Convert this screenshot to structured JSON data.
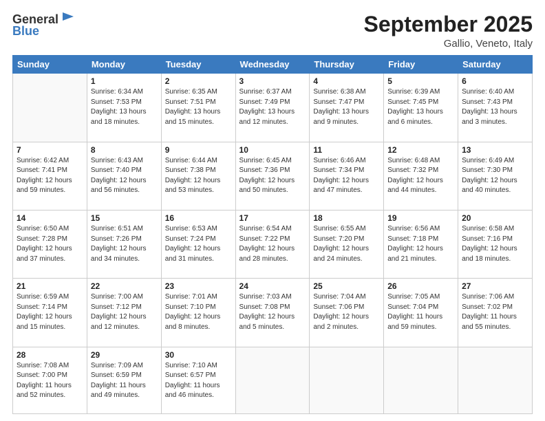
{
  "logo": {
    "line1": "General",
    "line2": "Blue"
  },
  "header": {
    "title": "September 2025",
    "subtitle": "Gallio, Veneto, Italy"
  },
  "days": [
    "Sunday",
    "Monday",
    "Tuesday",
    "Wednesday",
    "Thursday",
    "Friday",
    "Saturday"
  ],
  "weeks": [
    [
      {
        "num": "",
        "sunrise": "",
        "sunset": "",
        "daylight": "",
        "empty": true
      },
      {
        "num": "1",
        "sunrise": "Sunrise: 6:34 AM",
        "sunset": "Sunset: 7:53 PM",
        "daylight": "Daylight: 13 hours and 18 minutes."
      },
      {
        "num": "2",
        "sunrise": "Sunrise: 6:35 AM",
        "sunset": "Sunset: 7:51 PM",
        "daylight": "Daylight: 13 hours and 15 minutes."
      },
      {
        "num": "3",
        "sunrise": "Sunrise: 6:37 AM",
        "sunset": "Sunset: 7:49 PM",
        "daylight": "Daylight: 13 hours and 12 minutes."
      },
      {
        "num": "4",
        "sunrise": "Sunrise: 6:38 AM",
        "sunset": "Sunset: 7:47 PM",
        "daylight": "Daylight: 13 hours and 9 minutes."
      },
      {
        "num": "5",
        "sunrise": "Sunrise: 6:39 AM",
        "sunset": "Sunset: 7:45 PM",
        "daylight": "Daylight: 13 hours and 6 minutes."
      },
      {
        "num": "6",
        "sunrise": "Sunrise: 6:40 AM",
        "sunset": "Sunset: 7:43 PM",
        "daylight": "Daylight: 13 hours and 3 minutes."
      }
    ],
    [
      {
        "num": "7",
        "sunrise": "Sunrise: 6:42 AM",
        "sunset": "Sunset: 7:41 PM",
        "daylight": "Daylight: 12 hours and 59 minutes."
      },
      {
        "num": "8",
        "sunrise": "Sunrise: 6:43 AM",
        "sunset": "Sunset: 7:40 PM",
        "daylight": "Daylight: 12 hours and 56 minutes."
      },
      {
        "num": "9",
        "sunrise": "Sunrise: 6:44 AM",
        "sunset": "Sunset: 7:38 PM",
        "daylight": "Daylight: 12 hours and 53 minutes."
      },
      {
        "num": "10",
        "sunrise": "Sunrise: 6:45 AM",
        "sunset": "Sunset: 7:36 PM",
        "daylight": "Daylight: 12 hours and 50 minutes."
      },
      {
        "num": "11",
        "sunrise": "Sunrise: 6:46 AM",
        "sunset": "Sunset: 7:34 PM",
        "daylight": "Daylight: 12 hours and 47 minutes."
      },
      {
        "num": "12",
        "sunrise": "Sunrise: 6:48 AM",
        "sunset": "Sunset: 7:32 PM",
        "daylight": "Daylight: 12 hours and 44 minutes."
      },
      {
        "num": "13",
        "sunrise": "Sunrise: 6:49 AM",
        "sunset": "Sunset: 7:30 PM",
        "daylight": "Daylight: 12 hours and 40 minutes."
      }
    ],
    [
      {
        "num": "14",
        "sunrise": "Sunrise: 6:50 AM",
        "sunset": "Sunset: 7:28 PM",
        "daylight": "Daylight: 12 hours and 37 minutes."
      },
      {
        "num": "15",
        "sunrise": "Sunrise: 6:51 AM",
        "sunset": "Sunset: 7:26 PM",
        "daylight": "Daylight: 12 hours and 34 minutes."
      },
      {
        "num": "16",
        "sunrise": "Sunrise: 6:53 AM",
        "sunset": "Sunset: 7:24 PM",
        "daylight": "Daylight: 12 hours and 31 minutes."
      },
      {
        "num": "17",
        "sunrise": "Sunrise: 6:54 AM",
        "sunset": "Sunset: 7:22 PM",
        "daylight": "Daylight: 12 hours and 28 minutes."
      },
      {
        "num": "18",
        "sunrise": "Sunrise: 6:55 AM",
        "sunset": "Sunset: 7:20 PM",
        "daylight": "Daylight: 12 hours and 24 minutes."
      },
      {
        "num": "19",
        "sunrise": "Sunrise: 6:56 AM",
        "sunset": "Sunset: 7:18 PM",
        "daylight": "Daylight: 12 hours and 21 minutes."
      },
      {
        "num": "20",
        "sunrise": "Sunrise: 6:58 AM",
        "sunset": "Sunset: 7:16 PM",
        "daylight": "Daylight: 12 hours and 18 minutes."
      }
    ],
    [
      {
        "num": "21",
        "sunrise": "Sunrise: 6:59 AM",
        "sunset": "Sunset: 7:14 PM",
        "daylight": "Daylight: 12 hours and 15 minutes."
      },
      {
        "num": "22",
        "sunrise": "Sunrise: 7:00 AM",
        "sunset": "Sunset: 7:12 PM",
        "daylight": "Daylight: 12 hours and 12 minutes."
      },
      {
        "num": "23",
        "sunrise": "Sunrise: 7:01 AM",
        "sunset": "Sunset: 7:10 PM",
        "daylight": "Daylight: 12 hours and 8 minutes."
      },
      {
        "num": "24",
        "sunrise": "Sunrise: 7:03 AM",
        "sunset": "Sunset: 7:08 PM",
        "daylight": "Daylight: 12 hours and 5 minutes."
      },
      {
        "num": "25",
        "sunrise": "Sunrise: 7:04 AM",
        "sunset": "Sunset: 7:06 PM",
        "daylight": "Daylight: 12 hours and 2 minutes."
      },
      {
        "num": "26",
        "sunrise": "Sunrise: 7:05 AM",
        "sunset": "Sunset: 7:04 PM",
        "daylight": "Daylight: 11 hours and 59 minutes."
      },
      {
        "num": "27",
        "sunrise": "Sunrise: 7:06 AM",
        "sunset": "Sunset: 7:02 PM",
        "daylight": "Daylight: 11 hours and 55 minutes."
      }
    ],
    [
      {
        "num": "28",
        "sunrise": "Sunrise: 7:08 AM",
        "sunset": "Sunset: 7:00 PM",
        "daylight": "Daylight: 11 hours and 52 minutes."
      },
      {
        "num": "29",
        "sunrise": "Sunrise: 7:09 AM",
        "sunset": "Sunset: 6:59 PM",
        "daylight": "Daylight: 11 hours and 49 minutes."
      },
      {
        "num": "30",
        "sunrise": "Sunrise: 7:10 AM",
        "sunset": "Sunset: 6:57 PM",
        "daylight": "Daylight: 11 hours and 46 minutes."
      },
      {
        "num": "",
        "sunrise": "",
        "sunset": "",
        "daylight": "",
        "empty": true
      },
      {
        "num": "",
        "sunrise": "",
        "sunset": "",
        "daylight": "",
        "empty": true
      },
      {
        "num": "",
        "sunrise": "",
        "sunset": "",
        "daylight": "",
        "empty": true
      },
      {
        "num": "",
        "sunrise": "",
        "sunset": "",
        "daylight": "",
        "empty": true
      }
    ]
  ]
}
